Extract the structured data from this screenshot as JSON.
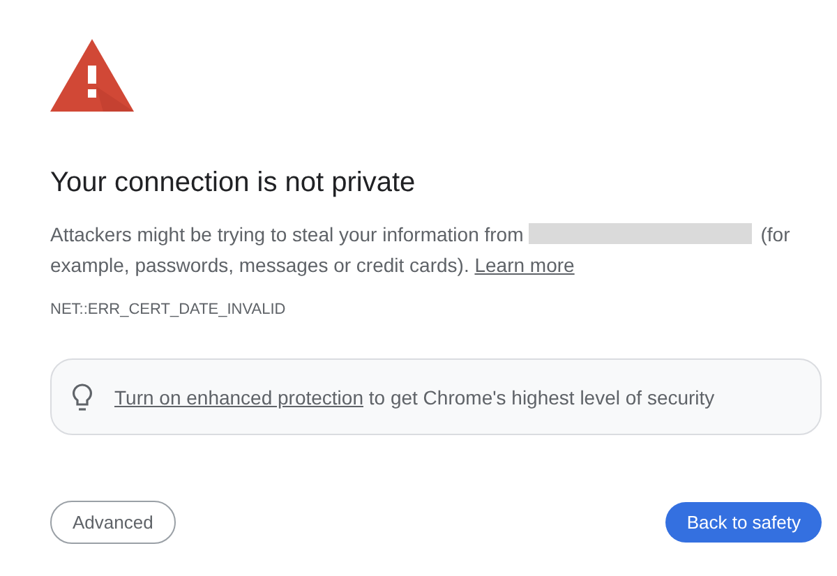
{
  "heading": "Your connection is not private",
  "message": {
    "before": "Attackers might be trying to steal your information from",
    "after": "(for example, passwords, messages or credit cards).",
    "link": "Learn more"
  },
  "error_code": "NET::ERR_CERT_DATE_INVALID",
  "tip": {
    "link": "Turn on enhanced protection",
    "text": "to get Chrome's highest level of security"
  },
  "buttons": [
    {
      "label": "Advanced",
      "kind": "secondary"
    },
    {
      "label": "Back to safety",
      "kind": "primary"
    }
  ]
}
